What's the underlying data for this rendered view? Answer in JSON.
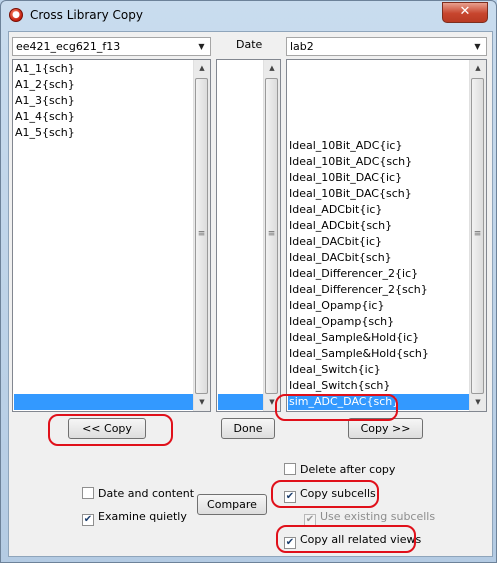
{
  "window": {
    "title": "Cross Library Copy",
    "close_glyph": "✕"
  },
  "left_library": {
    "selected": "ee421_ecg621_f13"
  },
  "middle": {
    "label": "Date"
  },
  "right_library": {
    "selected": "lab2"
  },
  "left_list": {
    "items": [
      "A1_1{sch}",
      "A1_2{sch}",
      "A1_3{sch}",
      "A1_4{sch}",
      "A1_5{sch}"
    ]
  },
  "right_list": {
    "items": [
      "Ideal_10Bit_ADC{ic}",
      "Ideal_10Bit_ADC{sch}",
      "Ideal_10Bit_DAC{ic}",
      "Ideal_10Bit_DAC{sch}",
      "Ideal_ADCbit{ic}",
      "Ideal_ADCbit{sch}",
      "Ideal_DACbit{ic}",
      "Ideal_DACbit{sch}",
      "Ideal_Differencer_2{ic}",
      "Ideal_Differencer_2{sch}",
      "Ideal_Opamp{ic}",
      "Ideal_Opamp{sch}",
      "Ideal_Sample&Hold{ic}",
      "Ideal_Sample&Hold{sch}",
      "Ideal_Switch{ic}",
      "Ideal_Switch{sch}",
      "sim_ADC_DAC{sch}"
    ],
    "selected_index": 16
  },
  "buttons": {
    "copy_left": "<< Copy",
    "done": "Done",
    "copy_right": "Copy >>",
    "compare": "Compare"
  },
  "options": {
    "date_and_content": {
      "label": "Date and content",
      "checked": false
    },
    "examine_quietly": {
      "label": "Examine quietly",
      "checked": true
    },
    "delete_after_copy": {
      "label": "Delete after copy",
      "checked": false
    },
    "copy_subcells": {
      "label": "Copy subcells",
      "checked": true
    },
    "use_existing_subcells": {
      "label": "Use existing subcells",
      "checked": true,
      "disabled": true
    },
    "copy_all_related_views": {
      "label": "Copy all related views",
      "checked": true
    }
  },
  "colors": {
    "annotation": "#e0101a",
    "selection": "#3399ff"
  },
  "icons": {
    "app": "cadence-logo-icon",
    "dropdown": "chevron-down-icon",
    "scroll_up": "scroll-up-arrow-icon",
    "scroll_down": "scroll-down-arrow-icon"
  }
}
